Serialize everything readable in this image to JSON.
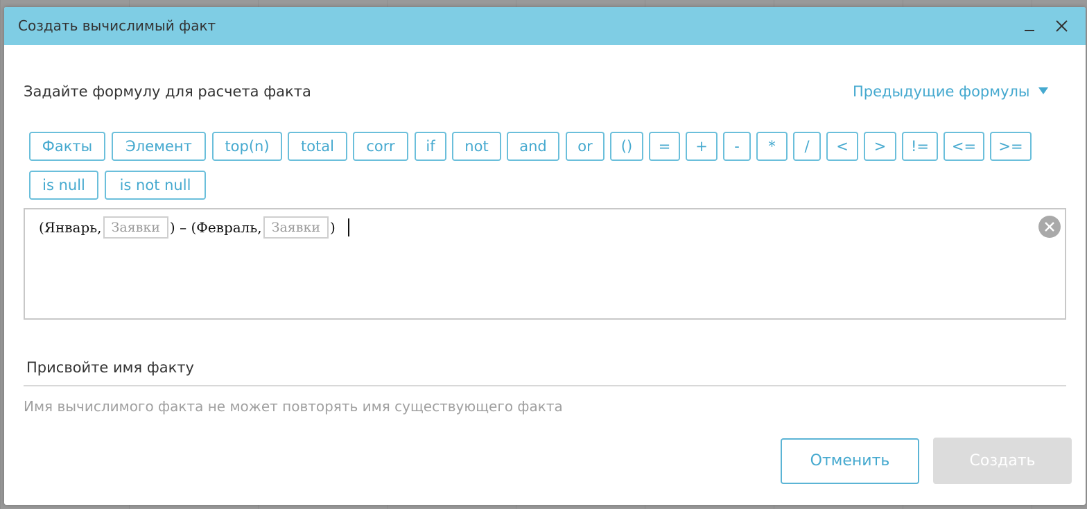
{
  "dialog": {
    "title": "Создать вычислимый факт",
    "prompt": "Задайте формулу для расчета факта",
    "previous_formulas_label": "Предыдущие формулы",
    "operators_row1": [
      "Факты",
      "Элемент",
      "top(n)",
      "total",
      "corr",
      "if",
      "not",
      "and",
      "or",
      "()",
      "=",
      "+",
      "-",
      "*",
      "/",
      "<",
      ">",
      "!=",
      "<=",
      ">="
    ],
    "operators_row2": [
      "is null",
      "is not null"
    ],
    "formula": {
      "open1": "(Январь,",
      "chip1": "Заявки",
      "mid": ") – (Февраль,",
      "chip2": "Заявки",
      "close": ")"
    },
    "name_label": "Присвойте имя факту",
    "name_hint": "Имя вычислимого факта не может повторять имя существующего факта",
    "cancel_label": "Отменить",
    "create_label": "Создать"
  },
  "colors": {
    "titlebar": "#7fcde4",
    "accent": "#45a9cf",
    "disabled_button": "#dcdcdc"
  },
  "icons": {
    "minimize": "minimize-icon",
    "close": "close-icon",
    "dropdown": "caret-down-icon",
    "clear": "clear-circle-icon"
  }
}
